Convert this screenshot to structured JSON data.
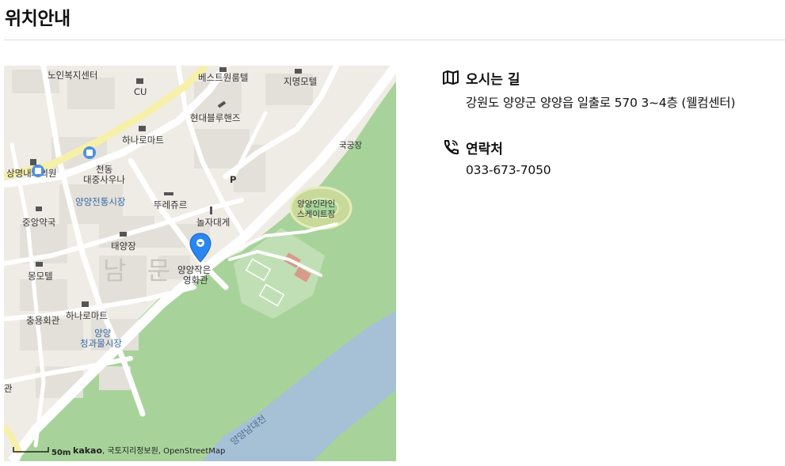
{
  "page": {
    "title": "위치안내"
  },
  "map": {
    "labels": {
      "noin": "노인복지센터",
      "cu": "CU",
      "best_room": "베스트원룸텔",
      "jimyeong": "지명모텔",
      "hyundai": "현대블루핸즈",
      "hana1": "하나로마트",
      "gukgung": "국궁장",
      "sangmyeong": "상명내과의원",
      "cheondong1": "천동",
      "cheondong2": "대중사우나",
      "market1": "양양전통시장",
      "ttureju": "뚜레쥬르",
      "nolja": "놀자대게",
      "inline1": "양양인라인",
      "inline2": "스케이트장",
      "jungang": "중앙약국",
      "taeyang": "태양장",
      "cinema1": "양양작은",
      "cinema2": "영화관",
      "mong": "몽모텔",
      "hana2": "하나로마트",
      "chungyong": "충용회관",
      "market2a": "양양",
      "market2b": "청과물시장",
      "nammun": "남 문",
      "river": "양양남대천",
      "gwan": "관",
      "p": "P"
    },
    "scale": "50m",
    "attribution_brand": "kakao",
    "attribution_rest": ", 국토지리정보원, OpenStreetMap",
    "colors": {
      "land": "#efece6",
      "road": "#ffffff",
      "park": "#a7d39a",
      "water": "#a6c0d6",
      "main_road": "#f6f0a9",
      "pin": "#2a86f1"
    }
  },
  "info": {
    "directions": {
      "icon": "map-icon",
      "label": "오시는 길",
      "value": "강원도 양양군 양양읍 일출로 570 3~4층 (웰컴센터)"
    },
    "contact": {
      "icon": "phone-icon",
      "label": "연락처",
      "value": "033-673-7050"
    }
  }
}
